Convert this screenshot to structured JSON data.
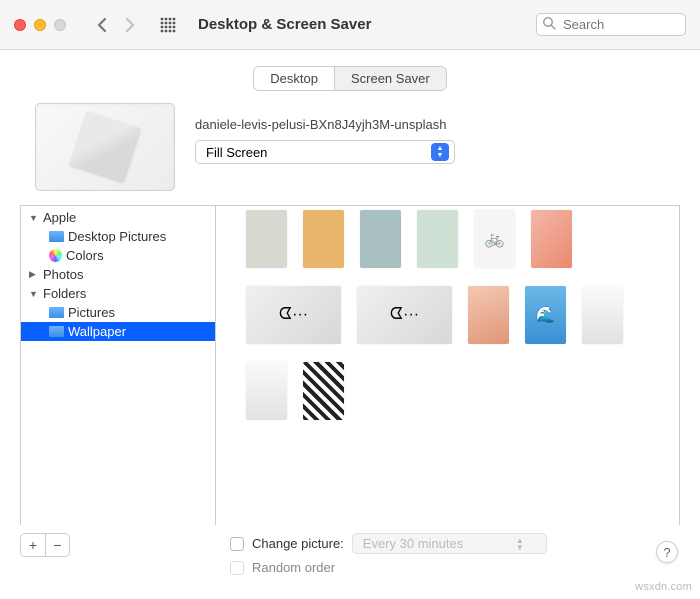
{
  "window": {
    "title": "Desktop & Screen Saver",
    "search_placeholder": "Search"
  },
  "tabs": [
    {
      "label": "Desktop",
      "active": true
    },
    {
      "label": "Screen Saver",
      "active": false
    }
  ],
  "preview": {
    "filename": "daniele-levis-pelusi-BXn8J4yjh3M-unsplash",
    "fill_mode": "Fill Screen"
  },
  "sidebar": {
    "items": [
      {
        "label": "Apple",
        "type": "group",
        "expanded": true
      },
      {
        "label": "Desktop Pictures",
        "type": "folder",
        "child": true
      },
      {
        "label": "Colors",
        "type": "colors",
        "child": true
      },
      {
        "label": "Photos",
        "type": "group",
        "expanded": false
      },
      {
        "label": "Folders",
        "type": "group",
        "expanded": true
      },
      {
        "label": "Pictures",
        "type": "folder",
        "child": true
      },
      {
        "label": "Wallpaper",
        "type": "folder",
        "child": true,
        "selected": true
      }
    ]
  },
  "thumbnails": [
    {
      "id": "t1",
      "bg": "#d9d9d2",
      "wide": false
    },
    {
      "id": "t2",
      "bg": "#e9b56a",
      "wide": false
    },
    {
      "id": "t3",
      "bg": "#a8c0c0",
      "wide": false
    },
    {
      "id": "t4",
      "bg": "#cfe0d4",
      "wide": false
    },
    {
      "id": "t5",
      "bg": "#f5f5f5",
      "wide": false,
      "emoji": "🚲"
    },
    {
      "id": "t6",
      "bg": "linear-gradient(135deg,#f5b8a8,#e88a70)",
      "wide": false
    },
    {
      "id": "t7",
      "bg": "linear-gradient(135deg,#f0f0f0,#d8d8d8)",
      "wide": true,
      "emoji": "ᗧ···"
    },
    {
      "id": "t8",
      "bg": "linear-gradient(135deg,#f0f0f0,#d8d8d8)",
      "wide": true,
      "emoji": "ᗧ···"
    },
    {
      "id": "t9",
      "bg": "linear-gradient(160deg,#f3c9b0,#e0967a)",
      "wide": false
    },
    {
      "id": "t10",
      "bg": "linear-gradient(#6bb8e8,#3a8fd4)",
      "wide": false,
      "emoji": "🌊"
    },
    {
      "id": "t11",
      "bg": "linear-gradient(#fafafa,#e2e2e2)",
      "wide": false
    },
    {
      "id": "t12",
      "bg": "linear-gradient(#fafafa,#e2e2e2)",
      "wide": false
    },
    {
      "id": "t13",
      "bg": "repeating-linear-gradient(45deg,#222 0 4px,#fff 4px 8px)",
      "wide": false
    }
  ],
  "bottom": {
    "change_picture_label": "Change picture:",
    "interval_value": "Every 30 minutes",
    "random_order_label": "Random order"
  },
  "help_label": "?",
  "watermark": "wsxdn.com"
}
